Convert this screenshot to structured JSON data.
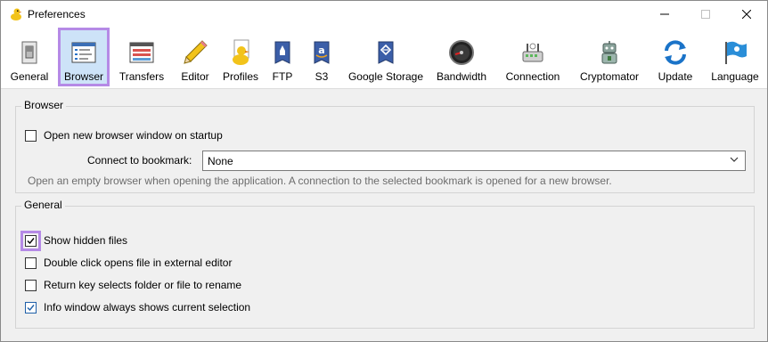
{
  "window": {
    "title": "Preferences"
  },
  "toolbar": {
    "items": [
      {
        "label": "General",
        "icon": "general-switch-icon"
      },
      {
        "label": "Browser",
        "icon": "browser-window-icon"
      },
      {
        "label": "Transfers",
        "icon": "transfers-window-icon"
      },
      {
        "label": "Editor",
        "icon": "pencil-icon"
      },
      {
        "label": "Profiles",
        "icon": "profiles-duck-icon"
      },
      {
        "label": "FTP",
        "icon": "ftp-rocket-icon"
      },
      {
        "label": "S3",
        "icon": "s3-amazon-icon"
      },
      {
        "label": "Google Storage",
        "icon": "google-storage-icon"
      },
      {
        "label": "Bandwidth",
        "icon": "bandwidth-gauge-icon"
      },
      {
        "label": "Connection",
        "icon": "connection-router-icon"
      },
      {
        "label": "Cryptomator",
        "icon": "cryptomator-robot-icon"
      },
      {
        "label": "Update",
        "icon": "update-arrows-icon"
      },
      {
        "label": "Language",
        "icon": "language-flag-icon"
      }
    ],
    "selected": "Browser"
  },
  "browser_group": {
    "title": "Browser",
    "open_new_window": {
      "label": "Open new browser window on startup",
      "checked": false
    },
    "connect_label": "Connect to bookmark:",
    "connect_value": "None",
    "hint": "Open an empty browser when opening the application. A connection to the selected bookmark is opened for a new browser."
  },
  "general_group": {
    "title": "General",
    "show_hidden": {
      "label": "Show hidden files",
      "checked": true
    },
    "double_click": {
      "label": "Double click opens file in external editor",
      "checked": false
    },
    "return_key": {
      "label": "Return key selects folder or file to rename",
      "checked": false
    },
    "info_window": {
      "label": "Info window always shows current selection",
      "checked": true
    }
  },
  "colors": {
    "highlight": "#b58ae6",
    "selected_bg": "#cde3f8",
    "check_blue": "#1e5fa8"
  }
}
